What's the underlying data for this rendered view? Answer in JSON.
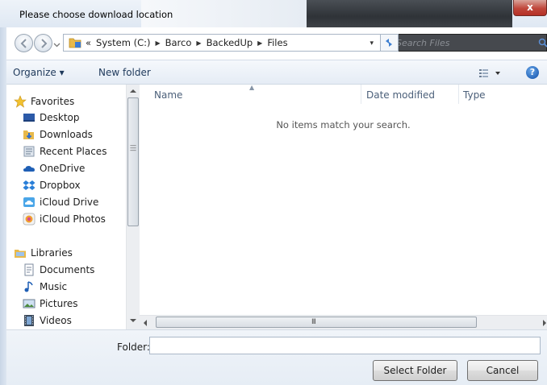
{
  "window": {
    "title": "Please choose download location",
    "close_label": "x"
  },
  "address": {
    "overflow": "«",
    "crumbs": [
      "System (C:)",
      "Barco",
      "BackedUp",
      "Files"
    ],
    "separator": "▶",
    "dropdown": "▾",
    "search_placeholder": "Search Files"
  },
  "toolbar": {
    "organize_label": "Organize ▾",
    "new_folder_label": "New folder",
    "help_label": "?"
  },
  "nav": {
    "favorites": {
      "label": "Favorites",
      "icon": "star-icon"
    },
    "favorite_items": [
      {
        "label": "Desktop",
        "icon": "desktop-icon"
      },
      {
        "label": "Downloads",
        "icon": "downloads-icon"
      },
      {
        "label": "Recent Places",
        "icon": "recent-places-icon"
      },
      {
        "label": "OneDrive",
        "icon": "onedrive-icon"
      },
      {
        "label": "Dropbox",
        "icon": "dropbox-icon"
      },
      {
        "label": "iCloud Drive",
        "icon": "icloud-drive-icon"
      },
      {
        "label": "iCloud Photos",
        "icon": "icloud-photos-icon"
      }
    ],
    "libraries": {
      "label": "Libraries",
      "icon": "libraries-icon"
    },
    "library_items": [
      {
        "label": "Documents",
        "icon": "documents-icon"
      },
      {
        "label": "Music",
        "icon": "music-icon"
      },
      {
        "label": "Pictures",
        "icon": "pictures-icon"
      },
      {
        "label": "Videos",
        "icon": "videos-icon"
      }
    ]
  },
  "content": {
    "columns": [
      "Name",
      "Date modified",
      "Type"
    ],
    "empty_message": "No items match your search.",
    "scroll_grip": "III"
  },
  "footer": {
    "folder_label": "Folder:",
    "folder_value": "",
    "select_button": "Select Folder",
    "cancel_button": "Cancel"
  },
  "colors": {
    "link_text": "#1e395b",
    "column_header": "#4c607a",
    "close_button": "#c0473b"
  }
}
